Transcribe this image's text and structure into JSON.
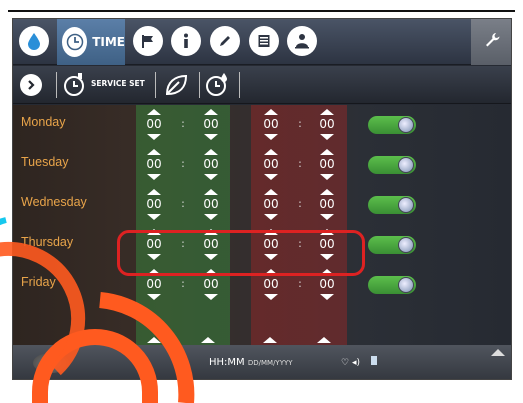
{
  "topnav": {
    "items": [
      {
        "icon": "water-drop-icon"
      },
      {
        "icon": "clock-icon",
        "label": "TIME"
      },
      {
        "icon": "flag-icon"
      },
      {
        "icon": "info-icon"
      },
      {
        "icon": "pencil-icon"
      },
      {
        "icon": "document-icon"
      },
      {
        "icon": "person-icon"
      }
    ],
    "settings_icon": "wrench-icon"
  },
  "subnav": {
    "service_label": "SERVICE SET"
  },
  "schedule": {
    "rows": [
      {
        "day": "Monday",
        "on_h": "00",
        "on_m": "00",
        "off_h": "00",
        "off_m": "00",
        "enabled": true
      },
      {
        "day": "Tuesday",
        "on_h": "00",
        "on_m": "00",
        "off_h": "00",
        "off_m": "00",
        "enabled": true
      },
      {
        "day": "Wednesday",
        "on_h": "00",
        "on_m": "00",
        "off_h": "00",
        "off_m": "00",
        "enabled": true
      },
      {
        "day": "Thursday",
        "on_h": "00",
        "on_m": "00",
        "off_h": "00",
        "off_m": "00",
        "enabled": true
      },
      {
        "day": "Friday",
        "on_h": "00",
        "on_m": "00",
        "off_h": "00",
        "off_m": "00",
        "enabled": true
      }
    ],
    "separator": ":",
    "highlighted_day": "Thursday"
  },
  "statusbar": {
    "time_format": "HH:MM",
    "date_format": "DD/MM/YYYY"
  },
  "colors": {
    "day_label": "#e8a44a",
    "toggle_on": "#5cbf4c",
    "highlight": "#dd2222",
    "overlay_orange": "#ff5a1f",
    "overlay_cyan": "#16c8ee"
  }
}
